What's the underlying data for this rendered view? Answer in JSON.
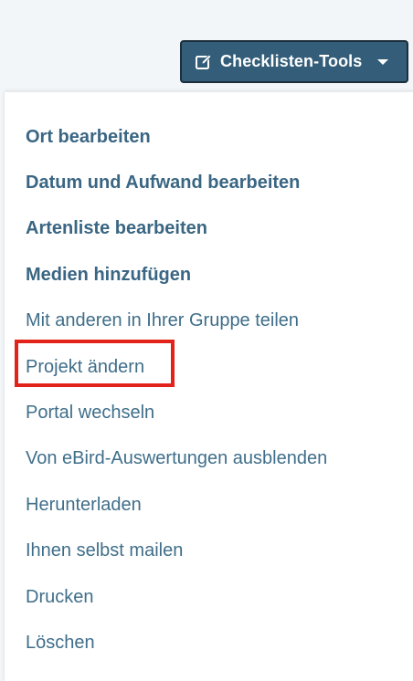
{
  "toolbar": {
    "tools_button_label": "Checklisten-Tools",
    "tools_button_icon": "edit-icon",
    "tools_button_caret": "chevron-down-icon",
    "button_color": "#335d78"
  },
  "menu": {
    "items": [
      {
        "label": "Ort bearbeiten",
        "bold": true
      },
      {
        "label": "Datum und Aufwand bearbeiten",
        "bold": true
      },
      {
        "label": "Artenliste bearbeiten",
        "bold": true
      },
      {
        "label": "Medien hinzufügen",
        "bold": true
      },
      {
        "label": "Mit anderen in Ihrer Gruppe teilen",
        "bold": false
      },
      {
        "label": "Projekt ändern",
        "bold": false,
        "highlighted": true
      },
      {
        "label": "Portal wechseln",
        "bold": false
      },
      {
        "label": "Von eBird-Auswertungen ausblenden",
        "bold": false
      },
      {
        "label": "Herunterladen",
        "bold": false
      },
      {
        "label": "Ihnen selbst mailen",
        "bold": false
      },
      {
        "label": "Drucken",
        "bold": false
      },
      {
        "label": "Löschen",
        "bold": false
      }
    ],
    "text_color": "#3f6e8a",
    "highlight_color": "#e2231a"
  }
}
